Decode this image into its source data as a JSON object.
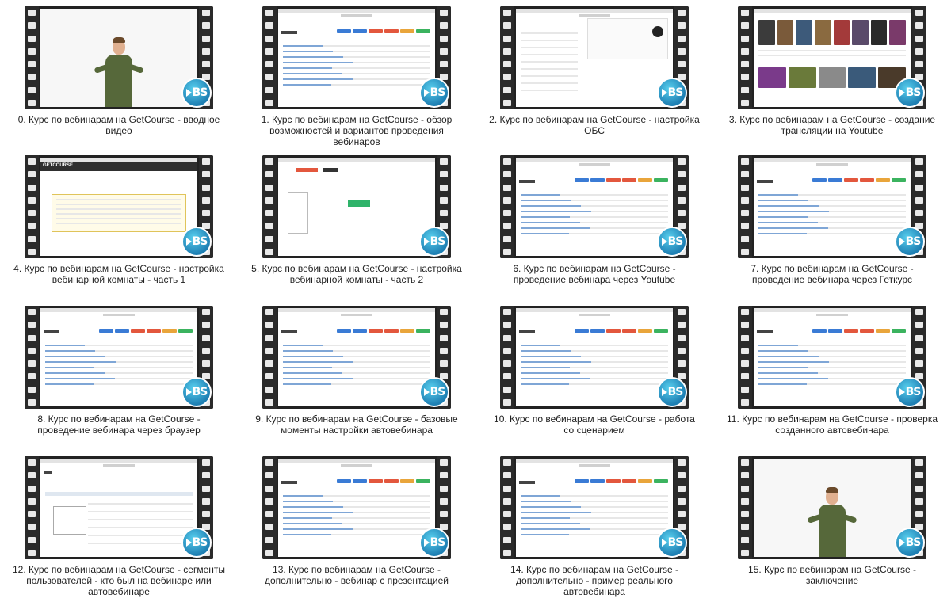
{
  "badge_text": "BS",
  "colors": {
    "film_strip": "#2a2a2a",
    "badge": "#1e7fb3",
    "shirt": "#56683a"
  },
  "items": [
    {
      "caption": "0. Курс по вебинарам на GetCourse - вводное видео",
      "kind": "person"
    },
    {
      "caption": "1. Курс по вебинарам на GetCourse - обзор возможностей и вариантов проведения вебинаров",
      "kind": "table"
    },
    {
      "caption": "2. Курс по вебинарам на GetCourse - настройка ОБС",
      "kind": "obs"
    },
    {
      "caption": "3. Курс по вебинарам на GetCourse - создание трансляции на Youtube",
      "kind": "youtube"
    },
    {
      "caption": "4. Курс по вебинарам на GetCourse - настройка вебинарной комнаты - часть 1",
      "kind": "getcourse"
    },
    {
      "caption": "5. Курс по вебинарам на GetCourse - настройка вебинарной комнаты - часть 2",
      "kind": "room"
    },
    {
      "caption": "6. Курс по вебинарам на GetCourse - проведение вебинара через Youtube",
      "kind": "table"
    },
    {
      "caption": "7. Курс по вебинарам на GetCourse - проведение вебинара через Геткурс",
      "kind": "table"
    },
    {
      "caption": "8. Курс по вебинарам на GetCourse - проведение вебинара через браузер",
      "kind": "table"
    },
    {
      "caption": "9. Курс по вебинарам на GetCourse - базовые моменты настройки автовебинара",
      "kind": "table"
    },
    {
      "caption": "10. Курс по вебинарам на GetCourse - работа со сценарием",
      "kind": "table"
    },
    {
      "caption": "11. Курс по вебинарам на GetCourse - проверка созданного автовебинара",
      "kind": "table"
    },
    {
      "caption": "12. Курс по вебинарам на GetCourse - сегменты пользователей - кто был на вебинаре или автовебинаре",
      "kind": "segments"
    },
    {
      "caption": "13. Курс по вебинарам на GetCourse - дополнительно - вебинар с презентацией",
      "kind": "table"
    },
    {
      "caption": "14. Курс по вебинарам на GetCourse - дополнительно - пример реального автовебинара",
      "kind": "table"
    },
    {
      "caption": "15. Курс по вебинарам на GetCourse - заключение",
      "kind": "person"
    }
  ]
}
